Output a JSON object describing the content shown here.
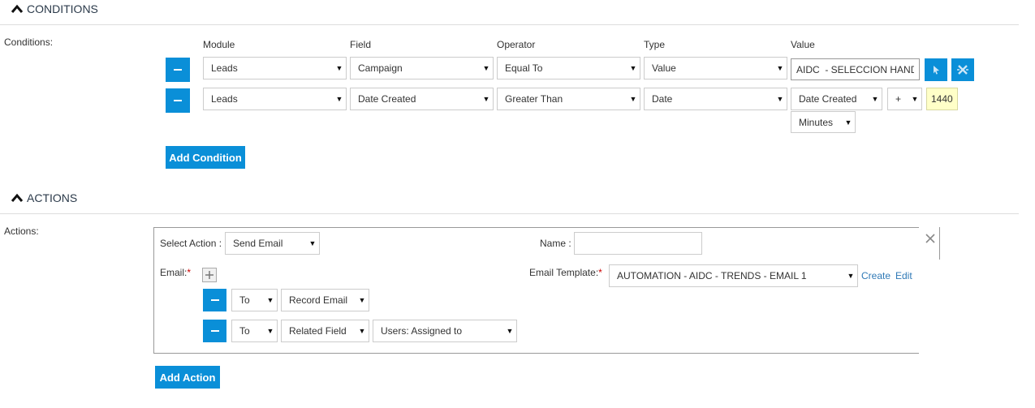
{
  "conditions_section": {
    "title": "CONDITIONS",
    "label": "Conditions:",
    "headers": {
      "module": "Module",
      "field": "Field",
      "operator": "Operator",
      "type": "Type",
      "value": "Value"
    },
    "rows": [
      {
        "module": "Leads",
        "field": "Campaign",
        "operator": "Equal To",
        "type": "Value",
        "value_text": "AIDC  - SELECCION HANDS"
      },
      {
        "module": "Leads",
        "field": "Date Created",
        "operator": "Greater Than",
        "type": "Date",
        "date_field": "Date Created",
        "sign": "+",
        "amount": "1440",
        "unit": "Minutes"
      }
    ],
    "add_button": "Add Condition"
  },
  "actions_section": {
    "title": "ACTIONS",
    "label": "Actions:",
    "select_action_label": "Select Action :",
    "select_action_value": "Send Email",
    "name_label": "Name :",
    "name_value": "",
    "email_label": "Email:",
    "required_mark": "*",
    "email_template_label": "Email Template:",
    "email_template_value": "AUTOMATION - AIDC - TRENDS - EMAIL 1",
    "create_link": "Create",
    "edit_link": "Edit",
    "recipients": [
      {
        "to": "To",
        "kind": "Record Email"
      },
      {
        "to": "To",
        "kind": "Related Field",
        "field": "Users: Assigned to"
      }
    ],
    "add_button": "Add Action"
  },
  "colors": {
    "accent": "#0a8fd8",
    "highlight": "#ffffc8",
    "link": "#2f79b6",
    "required": "#cc0000"
  },
  "icons": [
    "chevron-up-icon",
    "caret-down-icon",
    "minus-icon",
    "select-arrow-icon",
    "clear-icon",
    "plus-icon",
    "close-icon"
  ]
}
